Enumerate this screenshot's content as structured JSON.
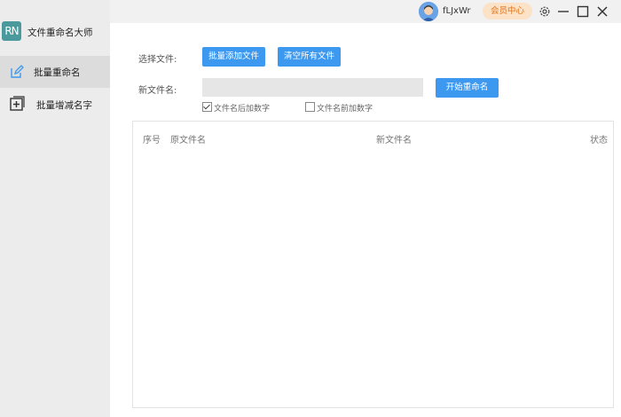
{
  "app": {
    "logo_text": "RN",
    "title": "文件重命名大师"
  },
  "sidebar": {
    "items": [
      {
        "label": "批量重命名",
        "icon": "edit-icon",
        "active": true
      },
      {
        "label": "批量增减名字",
        "icon": "add-box-icon",
        "active": false
      }
    ]
  },
  "titlebar": {
    "username": "fLJxWr",
    "vip_label": "会员中心",
    "icons": [
      "settings-icon",
      "minimize-icon",
      "maximize-icon",
      "close-icon"
    ]
  },
  "form": {
    "select_files_label": "选择文件:",
    "batch_add_button": "批量添加文件",
    "clear_all_button": "清空所有文件",
    "new_name_label": "新文件名:",
    "new_name_value": "",
    "start_rename_button": "开始重命名",
    "suffix_number_label": "文件名后加数字",
    "suffix_number_checked": true,
    "prefix_number_label": "文件名前加数字",
    "prefix_number_checked": false
  },
  "table": {
    "columns": [
      "序号",
      "原文件名",
      "新文件名",
      "状态"
    ],
    "rows": []
  },
  "colors": {
    "accent_blue": "#3d99f0",
    "logo_teal": "#4a9a9d",
    "vip_bg": "#fce2c6",
    "vip_text": "#e0741d"
  }
}
